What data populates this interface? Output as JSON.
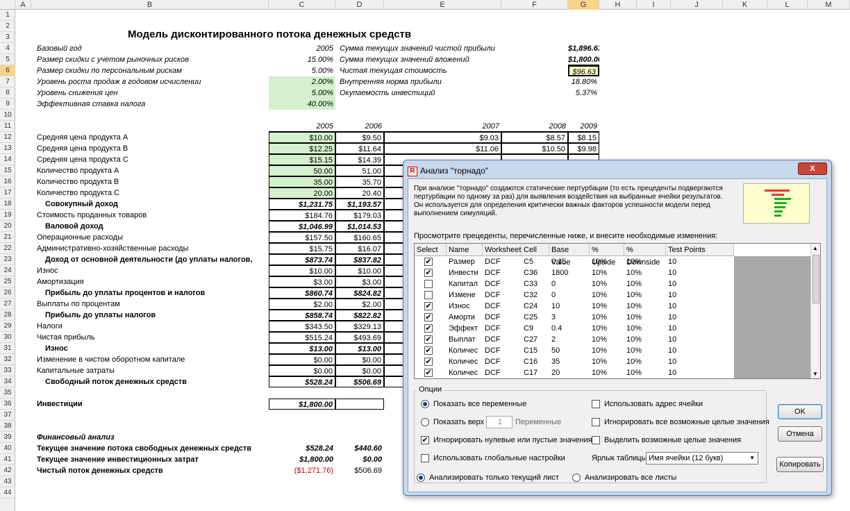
{
  "columns": [
    "A",
    "B",
    "C",
    "D",
    "E",
    "F",
    "G",
    "H",
    "I",
    "J",
    "K",
    "L",
    "M"
  ],
  "selected_column": "G",
  "rows": [
    "1",
    "2",
    "3",
    "4",
    "5",
    "6",
    "7",
    "8",
    "9",
    "10",
    "11",
    "12",
    "13",
    "14",
    "15",
    "16",
    "17",
    "18",
    "19",
    "20",
    "21",
    "22",
    "23",
    "24",
    "25",
    "26",
    "27",
    "28",
    "29",
    "30",
    "31",
    "32",
    "33",
    "34",
    "35",
    "36",
    "37",
    "38",
    "39",
    "40",
    "41",
    "42",
    "43",
    "44"
  ],
  "selected_row": "6",
  "sheet": {
    "title": "Модель дисконтированного потока денежных средств",
    "params": [
      {
        "label": "Базовый год",
        "value": "2005"
      },
      {
        "label": "Размер скидки с учетом рыночных рисков",
        "value": "15.00%"
      },
      {
        "label": "Размер скидки по персональным рискам",
        "value": "5.00%"
      },
      {
        "label": "Уровень роста продаж в годовом исчислении",
        "value": "2.00%"
      },
      {
        "label": "Уровень снижения цен",
        "value": "5.00%"
      },
      {
        "label": "Эффективная ставка налога",
        "value": "40.00%"
      }
    ],
    "summary": [
      {
        "label": "Сумма текущих значений чистой прибыли",
        "value": "$1,896.63"
      },
      {
        "label": "Сумма текущих значений вложений",
        "value": "$1,800.00"
      },
      {
        "label": "Чистая текущая стоимость",
        "value": "$96.63"
      },
      {
        "label": "Внутренняя норма прибыли",
        "value": "18.80%"
      },
      {
        "label": "Окупаемость инвестиций",
        "value": "5.37%"
      }
    ],
    "years": [
      "2005",
      "2006",
      "2007",
      "2008",
      "2009"
    ],
    "lines": [
      {
        "label": "Средняя цена продукта A",
        "v": [
          "$10.00",
          "$9.50",
          "$9.03",
          "$8.57",
          "$8.15"
        ]
      },
      {
        "label": "Средняя цена продукта B",
        "v": [
          "$12.25",
          "$11.64",
          "$11.06",
          "$10.50",
          "$9.98"
        ]
      },
      {
        "label": "Средняя цена продукта C",
        "v": [
          "$15.15",
          "$14.39",
          "",
          "",
          ""
        ]
      },
      {
        "label": "Количество продукта A",
        "v": [
          "50.00",
          "51.00",
          "",
          "",
          ""
        ]
      },
      {
        "label": "Количество продукта B",
        "v": [
          "35.00",
          "35.70",
          "",
          "",
          ""
        ]
      },
      {
        "label": "Количество продукта C",
        "v": [
          "20.00",
          "20.40",
          "",
          "",
          ""
        ]
      },
      {
        "label": "Совокупный доход",
        "v": [
          "$1,231.75",
          "$1,193.57",
          "",
          "",
          ""
        ]
      },
      {
        "label": "Стоимость проданных товаров",
        "v": [
          "$184.76",
          "$179.03",
          "",
          "",
          ""
        ]
      },
      {
        "label": "Валовой доход",
        "v": [
          "$1,046.99",
          "$1,014.53",
          "",
          "",
          ""
        ]
      },
      {
        "label": "Операционные расходы",
        "v": [
          "$157.50",
          "$160.65",
          "",
          "",
          ""
        ]
      },
      {
        "label": "Административно-хозяйственные расходы",
        "v": [
          "$15.75",
          "$16.07",
          "",
          "",
          ""
        ]
      },
      {
        "label": "Доход от основной деятельности (до уплаты налогов,",
        "v": [
          "$873.74",
          "$837.82",
          "",
          "",
          ""
        ]
      },
      {
        "label": "Износ",
        "v": [
          "$10.00",
          "$10.00",
          "",
          "",
          ""
        ]
      },
      {
        "label": "Амортизация",
        "v": [
          "$3.00",
          "$3.00",
          "",
          "",
          ""
        ]
      },
      {
        "label": "Прибыль до уплаты процентов и налогов",
        "v": [
          "$860.74",
          "$824.82",
          "",
          "",
          ""
        ]
      },
      {
        "label": "Выплаты по процентам",
        "v": [
          "$2.00",
          "$2.00",
          "",
          "",
          ""
        ]
      },
      {
        "label": "Прибыль до уплаты налогов",
        "v": [
          "$858.74",
          "$822.82",
          "",
          "",
          ""
        ]
      },
      {
        "label": "Налоги",
        "v": [
          "$343.50",
          "$329.13",
          "",
          "",
          ""
        ]
      },
      {
        "label": "Чистая прибыль",
        "v": [
          "$515.24",
          "$493.69",
          "",
          "",
          ""
        ]
      },
      {
        "label": "Износ",
        "v": [
          "$13.00",
          "$13.00",
          "",
          "",
          ""
        ]
      },
      {
        "label": "Изменение в чистом оборотном капитале",
        "v": [
          "$0.00",
          "$0.00",
          "",
          "",
          ""
        ]
      },
      {
        "label": "Капитальные затраты",
        "v": [
          "$0.00",
          "$0.00",
          "",
          "",
          ""
        ]
      },
      {
        "label": "Свободный поток денежных средств",
        "v": [
          "$528.24",
          "$506.69",
          "",
          "",
          ""
        ]
      }
    ],
    "investments_label": "Инвестиции",
    "investments_value": "$1,800.00",
    "fin_title": "Финансовый анализ",
    "fin": [
      {
        "label": "Текущее значение потока свободных денежных средств",
        "c": "$528.24",
        "d": "$440.60"
      },
      {
        "label": "Текущее значение инвестиционных затрат",
        "c": "$1,800.00",
        "d": "$0.00"
      },
      {
        "label": "Чистый поток денежных средств",
        "c": "($1,271.76)",
        "d": "$506.69"
      }
    ]
  },
  "dialog": {
    "title": "Анализ \"торнадо\"",
    "close": "X",
    "description": "При анализе \"торнадо\" создаются статические пертурбации (то есть прецеденты подвергаются пертурбации по одному за раз) для выявления воздействия на выбранные ячейки результатов. Он используется для определения критически важных факторов успешности модели перед выполнением симуляций.",
    "review_text": "Просмотрите прецеденты, перечисленные ниже, и внесите необходимые изменения:",
    "headers": [
      "Select",
      "Name",
      "Worksheet",
      "Cell",
      "Base Value",
      "% Upside",
      "% Downside",
      "Test Points"
    ],
    "rows": [
      {
        "checked": true,
        "name": "Размер",
        "ws": "DCF",
        "cell": "C5",
        "base": "0.15",
        "up": "10%",
        "down": "10%",
        "tp": "10"
      },
      {
        "checked": true,
        "name": "Инвести",
        "ws": "DCF",
        "cell": "C36",
        "base": "1800",
        "up": "10%",
        "down": "10%",
        "tp": "10"
      },
      {
        "checked": false,
        "name": "Капитал",
        "ws": "DCF",
        "cell": "C33",
        "base": "0",
        "up": "10%",
        "down": "10%",
        "tp": "10"
      },
      {
        "checked": false,
        "name": "Измене",
        "ws": "DCF",
        "cell": "C32",
        "base": "0",
        "up": "10%",
        "down": "10%",
        "tp": "10"
      },
      {
        "checked": true,
        "name": "Износ",
        "ws": "DCF",
        "cell": "C24",
        "base": "10",
        "up": "10%",
        "down": "10%",
        "tp": "10"
      },
      {
        "checked": true,
        "name": "Аморти",
        "ws": "DCF",
        "cell": "C25",
        "base": "3",
        "up": "10%",
        "down": "10%",
        "tp": "10"
      },
      {
        "checked": true,
        "name": "Эффект",
        "ws": "DCF",
        "cell": "C9",
        "base": "0.4",
        "up": "10%",
        "down": "10%",
        "tp": "10"
      },
      {
        "checked": true,
        "name": "Выплат",
        "ws": "DCF",
        "cell": "C27",
        "base": "2",
        "up": "10%",
        "down": "10%",
        "tp": "10"
      },
      {
        "checked": true,
        "name": "Количес",
        "ws": "DCF",
        "cell": "C15",
        "base": "50",
        "up": "10%",
        "down": "10%",
        "tp": "10"
      },
      {
        "checked": true,
        "name": "Количес",
        "ws": "DCF",
        "cell": "C16",
        "base": "35",
        "up": "10%",
        "down": "10%",
        "tp": "10"
      },
      {
        "checked": true,
        "name": "Количес",
        "ws": "DCF",
        "cell": "C17",
        "base": "20",
        "up": "10%",
        "down": "10%",
        "tp": "10"
      }
    ],
    "options_label": "Опции",
    "show_all": "Показать все переменные",
    "show_top": "Показать верх",
    "show_top_value": "1",
    "variables": "Переменные",
    "ignore_zero": "Игнорировать нулевые или пустые значения",
    "global_settings": "Использовать глобальные настройки",
    "use_address": "Использовать адрес ячейки",
    "ignore_int": "Игнорировать все возможные целые значения",
    "highlight_int": "Выделить возможные целые значения",
    "table_label": "Ярлык таблицы",
    "table_label_value": "Имя ячейки (12 букв)",
    "analyze_current": "Анализировать только текущий лист",
    "analyze_all": "Анализировать все листы",
    "ok": "OK",
    "cancel": "Отмена",
    "copy": "Копировать"
  }
}
